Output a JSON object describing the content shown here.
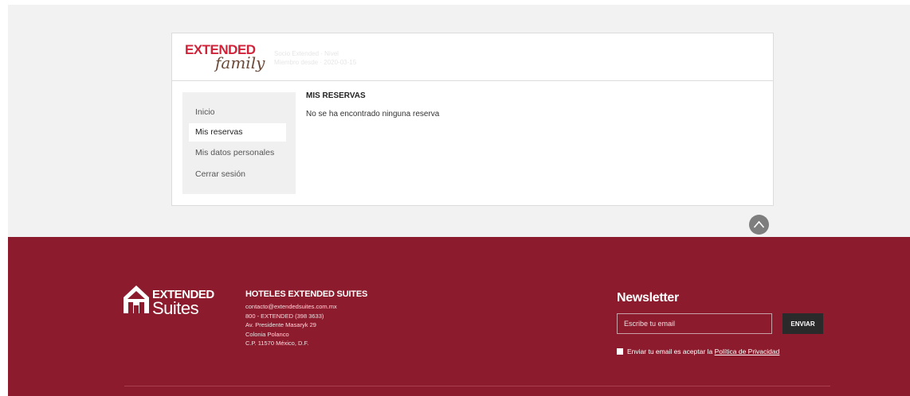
{
  "header": {
    "logo_word1": "EXTENDED",
    "logo_word2": "family",
    "member_line1": "Socio Extended · Nivel",
    "member_line2": "Miembro desde · 2020-03-15"
  },
  "sidebar": {
    "items": [
      {
        "label": "Inicio"
      },
      {
        "label": "Mis reservas"
      },
      {
        "label": "Mis datos personales"
      },
      {
        "label": "Cerrar sesión"
      }
    ]
  },
  "main": {
    "title": "MIS RESERVAS",
    "message": "No se ha encontrado ninguna reserva"
  },
  "footer": {
    "brand_word1": "EXTENDED",
    "brand_word2": "Suites",
    "hotel_heading": "HOTELES EXTENDED SUITES",
    "hotel_lines": [
      "contacto@extendedsuites.com.mx",
      "800 - EXTENDED (398 3633)",
      "Av. Presidente Masaryk 29",
      "Colonia Polanco",
      "C.P. 11570 México, D.F."
    ]
  },
  "newsletter": {
    "title": "Newsletter",
    "placeholder": "Escribe tu email",
    "button": "ENVIAR",
    "consent_text": "Enviar tu email es aceptar la ",
    "consent_link": "Política de Privacidad"
  },
  "colors": {
    "footer_bg": "#8c1c2d",
    "brand_red": "#d0233a"
  }
}
